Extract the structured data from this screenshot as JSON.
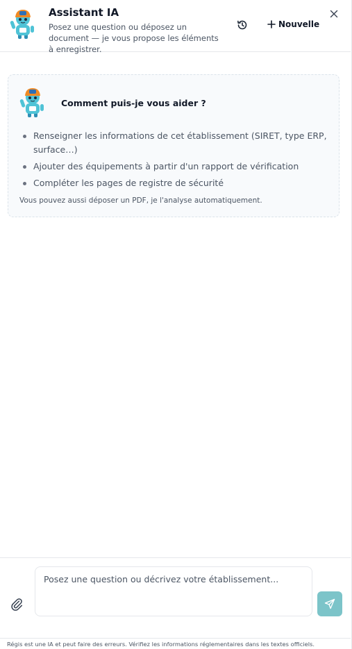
{
  "header": {
    "title": "Assistant IA",
    "subtitle": "Posez une question ou déposez un document — je vous propose les éléments à enregistrer.",
    "new_label": "Nouvelle",
    "icons": {
      "history": "history-icon",
      "new": "plus-icon",
      "close": "close-icon",
      "avatar": "robot-mascot-icon"
    }
  },
  "welcome": {
    "title": "Comment puis-je vous aider ?",
    "items": [
      "Renseigner les informations de cet établissement (SIRET, type ERP, surface…)",
      "Ajouter des équipements à partir d'un rapport de vérification",
      "Compléter les pages de registre de sécurité"
    ],
    "note": "Vous pouvez aussi déposer un PDF, je l'analyse automatiquement."
  },
  "composer": {
    "placeholder": "Posez une question ou décrivez votre établissement...",
    "value": "",
    "icons": {
      "attach": "paperclip-icon",
      "send": "send-icon"
    }
  },
  "footer": {
    "disclaimer": "Régis est une IA et peut faire des erreurs. Vérifiez les informations réglementaires dans les textes officiels."
  },
  "colors": {
    "accent": "#7cc4c9",
    "mascot_body": "#4fc3d6",
    "mascot_helmet": "#f08a24",
    "card_bg": "#f8fafc"
  }
}
